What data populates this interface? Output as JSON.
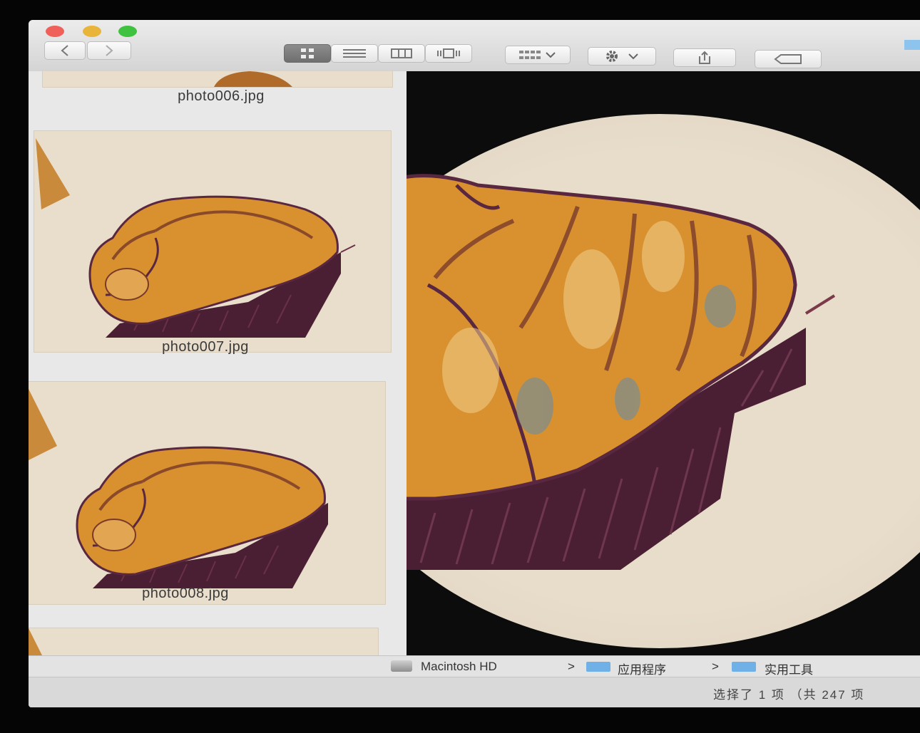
{
  "toolbar": {
    "back_icon": "chevron-left-icon",
    "forward_icon": "chevron-right-icon",
    "view_modes": [
      "icon-view",
      "list-view",
      "column-view",
      "coverflow-view"
    ],
    "active_view": "icon-view",
    "arrange_icon": "grid-arrange-icon",
    "action_icon": "gear-icon",
    "share_icon": "share-icon",
    "tag_icon": "tag-icon"
  },
  "thumbnails": [
    {
      "filename": "photo006.jpg"
    },
    {
      "filename": "photo007.jpg"
    },
    {
      "filename": "photo008.jpg"
    }
  ],
  "pathbar": {
    "items": [
      "Macintosh HD",
      "应用程序",
      "实用工具"
    ],
    "separator": ">"
  },
  "status": {
    "text": "选择了 1 项 （共 247 项"
  },
  "colors": {
    "paper": "#e9ddcb",
    "pastry_gold": "#d9912f",
    "shadow_plum": "#4a1f33",
    "accent_folder": "#6fb1e6"
  }
}
